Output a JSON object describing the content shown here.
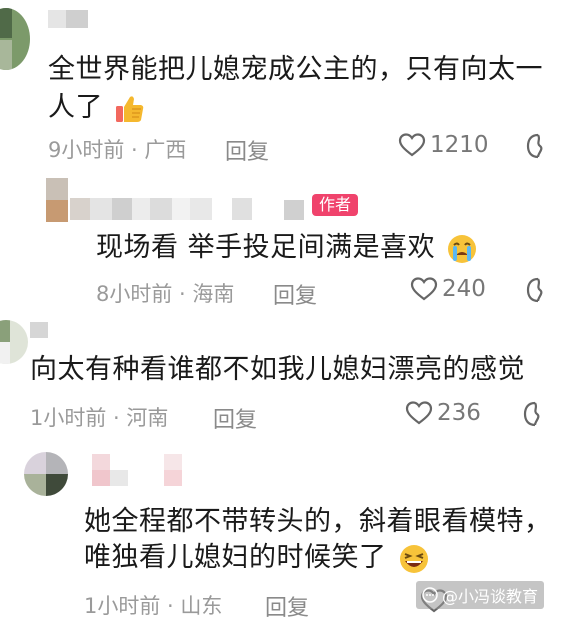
{
  "comments": [
    {
      "line1": "全世界能把儿媳宠成公主的，只有向太一",
      "line2": "人了",
      "time": "9小时前",
      "location": "广西",
      "reply": "回复",
      "likes": "1210",
      "emoji": "thumbs-up-icon"
    },
    {
      "badge": "作者",
      "line1": "现场看 举手投足间满是喜欢",
      "time": "8小时前",
      "location": "海南",
      "reply": "回复",
      "likes": "240",
      "emoji": "crying-face-icon"
    },
    {
      "line1": "向太有种看谁都不如我儿媳妇漂亮的感觉",
      "time": "1小时前",
      "location": "河南",
      "reply": "回复",
      "likes": "236"
    },
    {
      "line1": "她全程都不带转头的，斜着眼看模特，",
      "line2": "唯独看儿媳妇的时候笑了",
      "time": "1小时前",
      "location": "山东",
      "reply": "回复",
      "emoji": "laughing-face-icon"
    }
  ],
  "separator": " · ",
  "watermark": "@小冯谈教育",
  "colors": {
    "badge": "#f0436c",
    "meta": "#9a9a9a",
    "text": "#1a1a1a"
  }
}
